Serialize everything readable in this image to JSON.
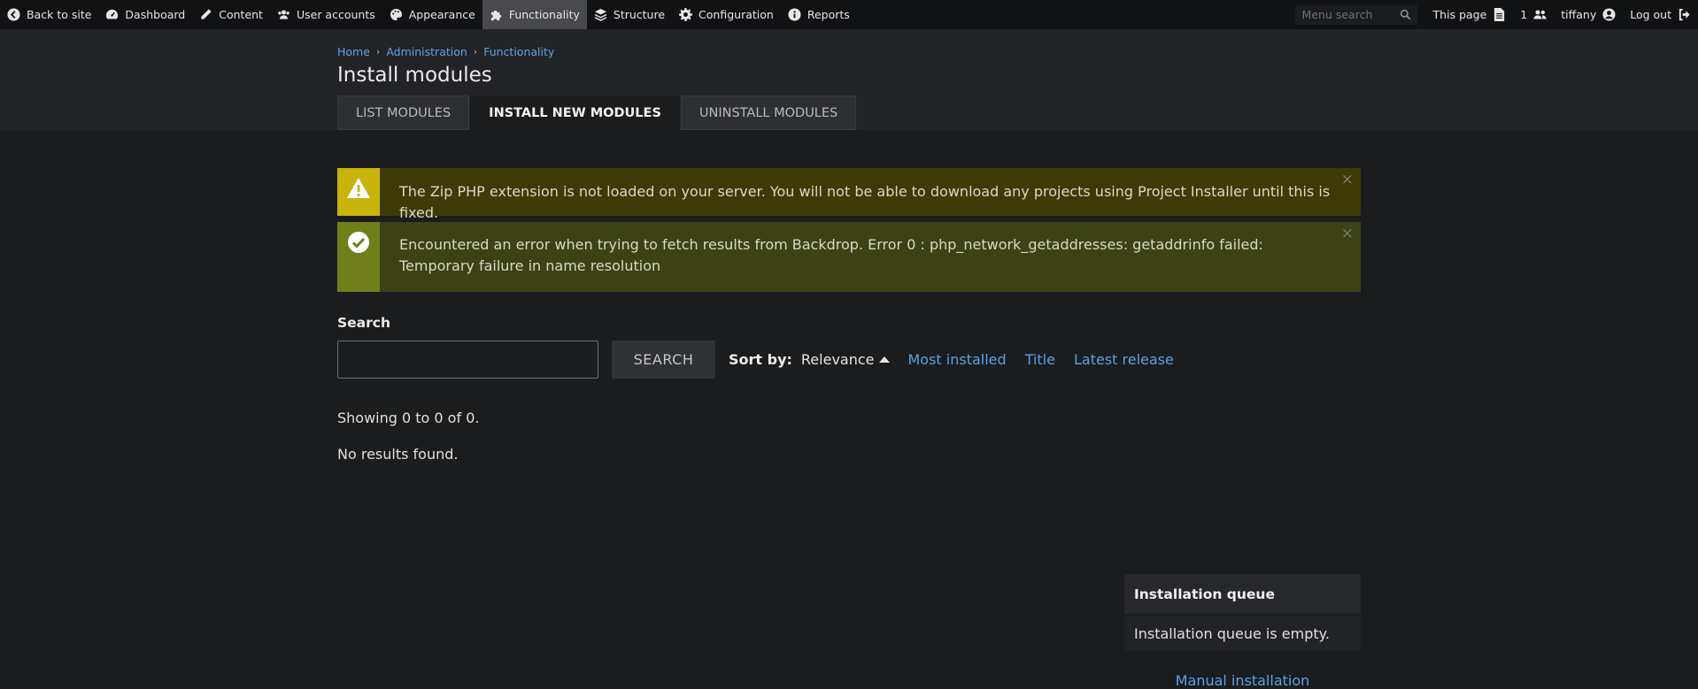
{
  "adminbar": {
    "left": [
      {
        "label": "Back to site",
        "icon": "arrow-circle-left-icon"
      },
      {
        "label": "Dashboard",
        "icon": "gauge-icon"
      },
      {
        "label": "Content",
        "icon": "pencil-icon"
      },
      {
        "label": "User accounts",
        "icon": "users-icon"
      },
      {
        "label": "Appearance",
        "icon": "palette-icon"
      },
      {
        "label": "Functionality",
        "icon": "puzzle-icon",
        "active": true
      },
      {
        "label": "Structure",
        "icon": "stack-icon"
      },
      {
        "label": "Configuration",
        "icon": "gear-icon"
      },
      {
        "label": "Reports",
        "icon": "info-icon"
      }
    ],
    "search_placeholder": "Menu search",
    "this_page": "This page",
    "user_count": "1",
    "username": "tiffany",
    "logout": "Log out"
  },
  "breadcrumb": {
    "home": "Home",
    "administration": "Administration",
    "functionality": "Functionality"
  },
  "page_title": "Install modules",
  "tabs": {
    "list": "LIST MODULES",
    "install": "INSTALL NEW MODULES",
    "uninstall": "UNINSTALL MODULES"
  },
  "messages": {
    "warning": "The Zip PHP extension is not loaded on your server. You will not be able to download any projects using Project Installer until this is fixed.",
    "status": "Encountered an error when trying to fetch results from Backdrop. Error 0 : php_network_getaddresses: getaddrinfo failed: Temporary failure in name resolution",
    "close": "×"
  },
  "search": {
    "label": "Search",
    "value": "",
    "button": "SEARCH"
  },
  "sort": {
    "label": "Sort by:",
    "current": "Relevance",
    "options": [
      "Most installed",
      "Title",
      "Latest release"
    ]
  },
  "results": {
    "showing": "Showing 0 to 0 of 0.",
    "none": "No results found."
  },
  "queue": {
    "title": "Installation queue",
    "empty": "Installation queue is empty.",
    "manual": "Manual installation"
  },
  "colors": {
    "accent_link": "#58a2e8",
    "warning_icon_bg": "#c8b40d",
    "status_icon_bg": "#717f1b"
  }
}
